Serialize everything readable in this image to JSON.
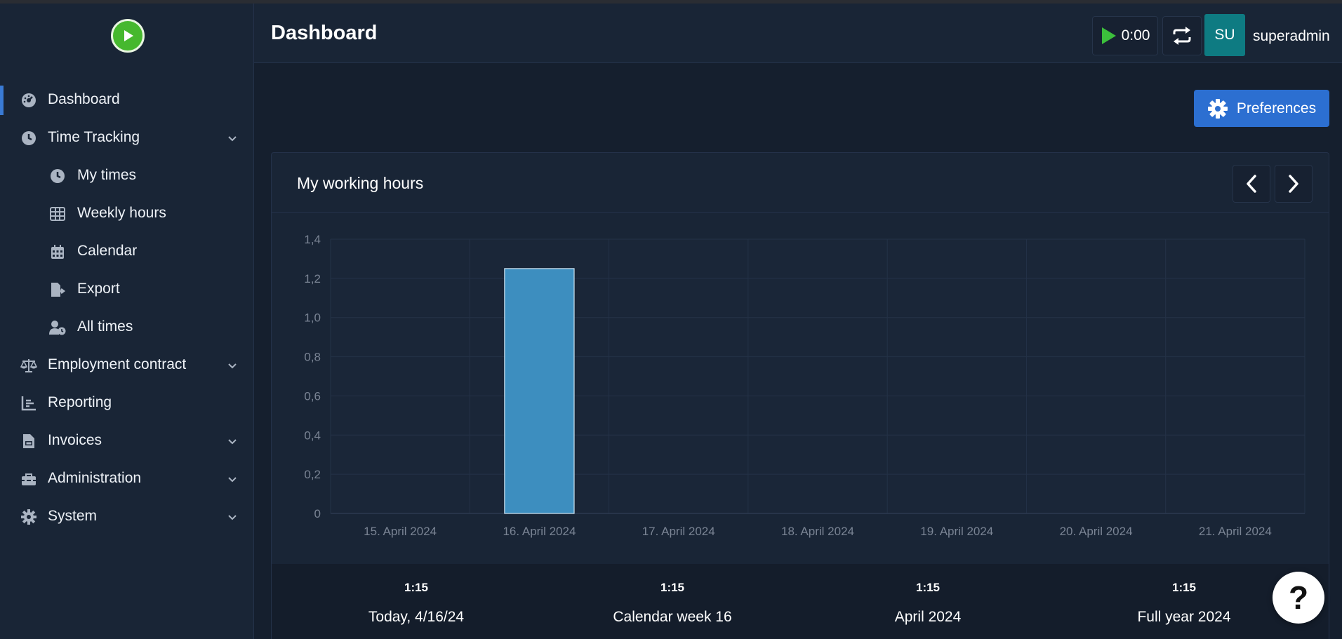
{
  "header": {
    "title": "Dashboard",
    "timer": "0:00",
    "avatar_initials": "SU",
    "username": "superadmin"
  },
  "sidebar": {
    "items": [
      {
        "label": "Dashboard",
        "icon": "dashboard-icon",
        "active": true,
        "expandable": false,
        "sub": false
      },
      {
        "label": "Time Tracking",
        "icon": "clock-icon",
        "active": false,
        "expandable": true,
        "sub": false
      },
      {
        "label": "My times",
        "icon": "clock-icon",
        "active": false,
        "expandable": false,
        "sub": true
      },
      {
        "label": "Weekly hours",
        "icon": "table-icon",
        "active": false,
        "expandable": false,
        "sub": true
      },
      {
        "label": "Calendar",
        "icon": "calendar-icon",
        "active": false,
        "expandable": false,
        "sub": true
      },
      {
        "label": "Export",
        "icon": "file-export-icon",
        "active": false,
        "expandable": false,
        "sub": true
      },
      {
        "label": "All times",
        "icon": "user-clock-icon",
        "active": false,
        "expandable": false,
        "sub": true
      },
      {
        "label": "Employment contract",
        "icon": "scale-icon",
        "active": false,
        "expandable": true,
        "sub": false
      },
      {
        "label": "Reporting",
        "icon": "chart-icon",
        "active": false,
        "expandable": false,
        "sub": false
      },
      {
        "label": "Invoices",
        "icon": "invoice-icon",
        "active": false,
        "expandable": true,
        "sub": false
      },
      {
        "label": "Administration",
        "icon": "toolbox-icon",
        "active": false,
        "expandable": true,
        "sub": false
      },
      {
        "label": "System",
        "icon": "gear-icon",
        "active": false,
        "expandable": true,
        "sub": false
      }
    ]
  },
  "main": {
    "preferences_label": "Preferences",
    "card_title": "My working hours",
    "stats": [
      {
        "value": "1:15",
        "label": "Today, 4/16/24"
      },
      {
        "value": "1:15",
        "label": "Calendar week 16"
      },
      {
        "value": "1:15",
        "label": "April 2024"
      },
      {
        "value": "1:15",
        "label": "Full year 2024"
      }
    ],
    "help_label": "?"
  },
  "colors": {
    "bar_fill": "#3d8ebf",
    "accent": "#2c6fd1",
    "logo_green": "#46b82e",
    "avatar_teal": "#0e7b82"
  },
  "chart_data": {
    "type": "bar",
    "categories": [
      "15. April 2024",
      "16. April 2024",
      "17. April 2024",
      "18. April 2024",
      "19. April 2024",
      "20. April 2024",
      "21. April 2024"
    ],
    "values": [
      0,
      1.25,
      0,
      0,
      0,
      0,
      0
    ],
    "yticks": [
      "0",
      "0,2",
      "0,4",
      "0,6",
      "0,8",
      "1,0",
      "1,2",
      "1,4"
    ],
    "ylim": [
      0,
      1.4
    ],
    "grid": true,
    "title": "",
    "xlabel": "",
    "ylabel": ""
  }
}
